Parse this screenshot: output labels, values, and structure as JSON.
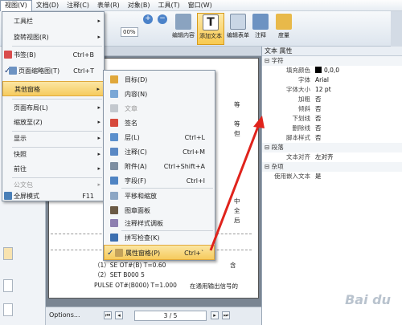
{
  "menubar": [
    "视图(V)",
    "文档(D)",
    "注释(C)",
    "表单(R)",
    "对象(B)",
    "工具(T)",
    "窗口(W)"
  ],
  "toolbar": {
    "zoom": "00%",
    "zoom_in": "+",
    "zoom_out": "−",
    "buttons": [
      "编辑内容",
      "添加文本",
      "编辑表单",
      "注释",
      "度量"
    ]
  },
  "view_menu": [
    {
      "label": "工具栏",
      "shortcut": "",
      "arrow": "▸"
    },
    {
      "label": "旋转视图(R)",
      "shortcut": "",
      "arrow": "▸"
    },
    {
      "label": "书签(B)",
      "shortcut": "Ctrl+B",
      "arrow": ""
    },
    {
      "label": "页面缩略图(T)",
      "shortcut": "Ctrl+T",
      "arrow": ""
    },
    {
      "label": "其他窗格",
      "shortcut": "",
      "arrow": "▸"
    },
    {
      "label": "页面布局(L)",
      "shortcut": "",
      "arrow": "▸"
    },
    {
      "label": "缩放至(Z)",
      "shortcut": "",
      "arrow": "▸"
    },
    {
      "label": "显示",
      "shortcut": "",
      "arrow": "▸"
    },
    {
      "label": "快照",
      "shortcut": "",
      "arrow": "▸"
    },
    {
      "label": "前往",
      "shortcut": "",
      "arrow": "▸"
    },
    {
      "label": "公文包",
      "shortcut": "",
      "arrow": "▸"
    },
    {
      "label": "全屏模式",
      "shortcut": "F11",
      "arrow": ""
    }
  ],
  "check_mark": "✓",
  "panes_menu": [
    {
      "label": "目标(D)",
      "shortcut": ""
    },
    {
      "label": "内容(N)",
      "shortcut": ""
    },
    {
      "label": "文章",
      "shortcut": ""
    },
    {
      "label": "签名",
      "shortcut": ""
    },
    {
      "label": "层(L)",
      "shortcut": "Ctrl+L"
    },
    {
      "label": "注释(C)",
      "shortcut": "Ctrl+M"
    },
    {
      "label": "附件(A)",
      "shortcut": "Ctrl+Shift+A"
    },
    {
      "label": "字段(F)",
      "shortcut": "Ctrl+I"
    },
    {
      "label": "平移和缩放",
      "shortcut": ""
    },
    {
      "label": "图章面板",
      "shortcut": ""
    },
    {
      "label": "注释样式调板",
      "shortcut": ""
    },
    {
      "label": "拼写检查(K)",
      "shortcut": ""
    },
    {
      "label": "属性窗格(P)",
      "shortcut": "Ctrl+`"
    }
  ],
  "document": {
    "line1": "（2）SET B000 5",
    "line2": "（1）SE OT#(B) T=0.60",
    "line3": "PULSE OT#(B000) T=1.000",
    "right1": "等",
    "right2": "等",
    "right3": "但",
    "right4": "中",
    "right5": "全",
    "right6": "后",
    "right7": "含",
    "right8": "在通用输出信号的",
    "options": "Options...",
    "page_indicator": "3 / 5",
    "nav_first": "⏮",
    "nav_prev": "◂",
    "nav_next": "▸",
    "nav_last": "⏭"
  },
  "properties": {
    "title": "文本 属性",
    "section_char": "字符",
    "fill_color_label": "填充颜色",
    "fill_color_value": "0,0,0",
    "font_label": "字体",
    "font_value": "Arial",
    "size_label": "字体大小",
    "size_value": "12 pt",
    "bold_label": "加粗",
    "bold_value": "否",
    "italic_label": "倾斜",
    "italic_value": "否",
    "underline_label": "下划线",
    "underline_value": "否",
    "strike_label": "删除线",
    "strike_value": "否",
    "script_label": "脚本样式",
    "script_value": "否",
    "section_para": "段落",
    "align_label": "文本对齐",
    "align_value": "左对齐",
    "section_misc": "杂项",
    "embed_label": "使用嵌入文本",
    "embed_value": "是"
  },
  "watermark": "Bai du",
  "colors": {
    "highlight": "#f6cb5e",
    "arrow": "#e0231c",
    "accent": "#4b82c9"
  }
}
